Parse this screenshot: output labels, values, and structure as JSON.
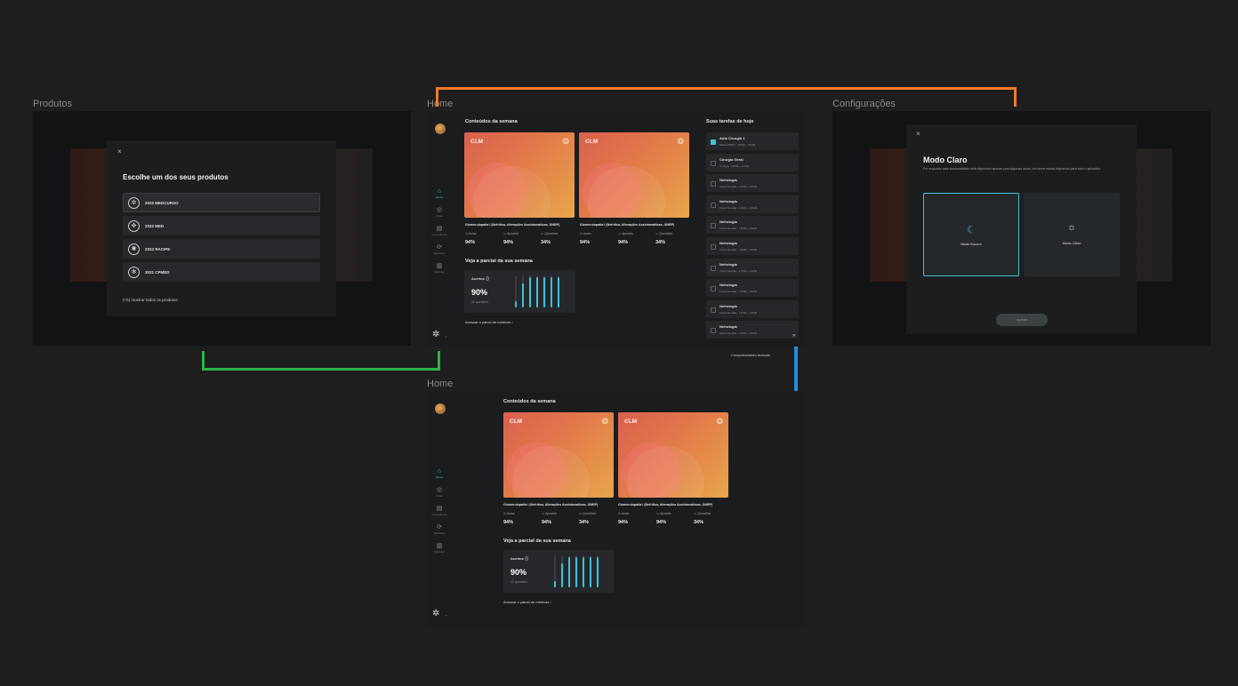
{
  "frames": {
    "produtos_label": "Produtos",
    "home_label": "Home",
    "home2_label": "Home",
    "config_label": "Configurações",
    "comportamento_label": "Comportamento fechado"
  },
  "colors": {
    "accent": "#3ec3d9",
    "wire_orange": "#f07a2a",
    "wire_green": "#2bb34a",
    "wire_blue": "#1e90e0",
    "dot_red": "#ff5f57",
    "dot_yellow": "#febc2e",
    "dot_green": "#28c840"
  },
  "produtos_modal": {
    "close": "×",
    "title": "Escolhe um dos seus produtos",
    "items": [
      {
        "icon": "medcurso-logo-icon",
        "name": "2022 MEDCURSO"
      },
      {
        "icon": "med-logo-icon",
        "name": "2022 MED"
      },
      {
        "icon": "racipe-logo-icon",
        "name": "2022 RACIPE"
      },
      {
        "icon": "cpmed-logo-icon",
        "name": "2021 CPMED"
      }
    ],
    "more": "(+5) mostrar todos os produtos"
  },
  "sidebar": {
    "items": [
      {
        "icon": "home-icon",
        "label": "Home"
      },
      {
        "icon": "target-icon",
        "label": "Aulas"
      },
      {
        "icon": "calendar-icon",
        "label": "Cronograma"
      },
      {
        "icon": "repeat-icon",
        "label": "Revisões"
      },
      {
        "icon": "chart-icon",
        "label": "Métricas"
      }
    ]
  },
  "home": {
    "contents_title": "Conteúdos da semana",
    "cards": [
      {
        "tag": "CLM",
        "caption": "Glomerulopatia I (Nefrítica, Alterações Assintomáticas, GNRP)"
      },
      {
        "tag": "CLM",
        "caption": "Glomerulopatia I (Nefrítica, Alterações Assintomáticas, GNRP)"
      }
    ],
    "stats": [
      {
        "label": "Aulas",
        "value": "94%"
      },
      {
        "label": "Apostila",
        "value": "94%"
      },
      {
        "label": "Questões",
        "value": "34%"
      }
    ],
    "partial_title": "Veja a parcial da sua semana",
    "metric_label": "Acertos",
    "metric_value": "90%",
    "metric_sub": "12 questões",
    "bars": [
      0.2,
      0.75,
      0.95,
      0.95,
      0.95,
      0.95,
      0.95
    ],
    "metrics_link": "Acessar o painel de métricas",
    "tasks_title": "Suas tarefas de hoje",
    "tasks": [
      {
        "title": "Aula Cirurgia 1",
        "meta": "MEDCURSO · 13h00 – 15h00",
        "done": true
      },
      {
        "title": "Cirurgia Geral",
        "meta": "Cirurgia · 15h00 – 17h00",
        "done": false
      },
      {
        "title": "Nefrologia",
        "meta": "Fazer Revisão · 17h00 – 19h00",
        "done": false
      },
      {
        "title": "Nefrologia",
        "meta": "Fazer Revisão · 17h00 – 19h00",
        "done": false
      },
      {
        "title": "Nefrologia",
        "meta": "Fazer Revisão · 17h00 – 19h00",
        "done": false
      },
      {
        "title": "Nefrologia",
        "meta": "Fazer Revisão · 17h00 – 19h00",
        "done": false
      },
      {
        "title": "Nefrologia",
        "meta": "Fazer Revisão · 17h00 – 19h00",
        "done": false
      },
      {
        "title": "Nefrologia",
        "meta": "Fazer Revisão · 17h00 – 19h00",
        "done": false
      },
      {
        "title": "Nefrologia",
        "meta": "Fazer Revisão · 17h00 – 19h00",
        "done": false
      },
      {
        "title": "Nefrologia",
        "meta": "Fazer Revisão · 17h00 – 19h00",
        "done": false
      }
    ],
    "collapse": "»"
  },
  "config_modal": {
    "close": "×",
    "title": "Modo Claro",
    "desc": "Por enquanto esta funcionalidade está disponível apenas para algumas áreas, em breve estará disponível para todo o aplicativo.",
    "options": [
      {
        "icon": "moon-icon",
        "label": "Modo Escuro"
      },
      {
        "icon": "sun-icon",
        "label": "Modo Claro"
      }
    ],
    "apply": "Aplicar"
  }
}
